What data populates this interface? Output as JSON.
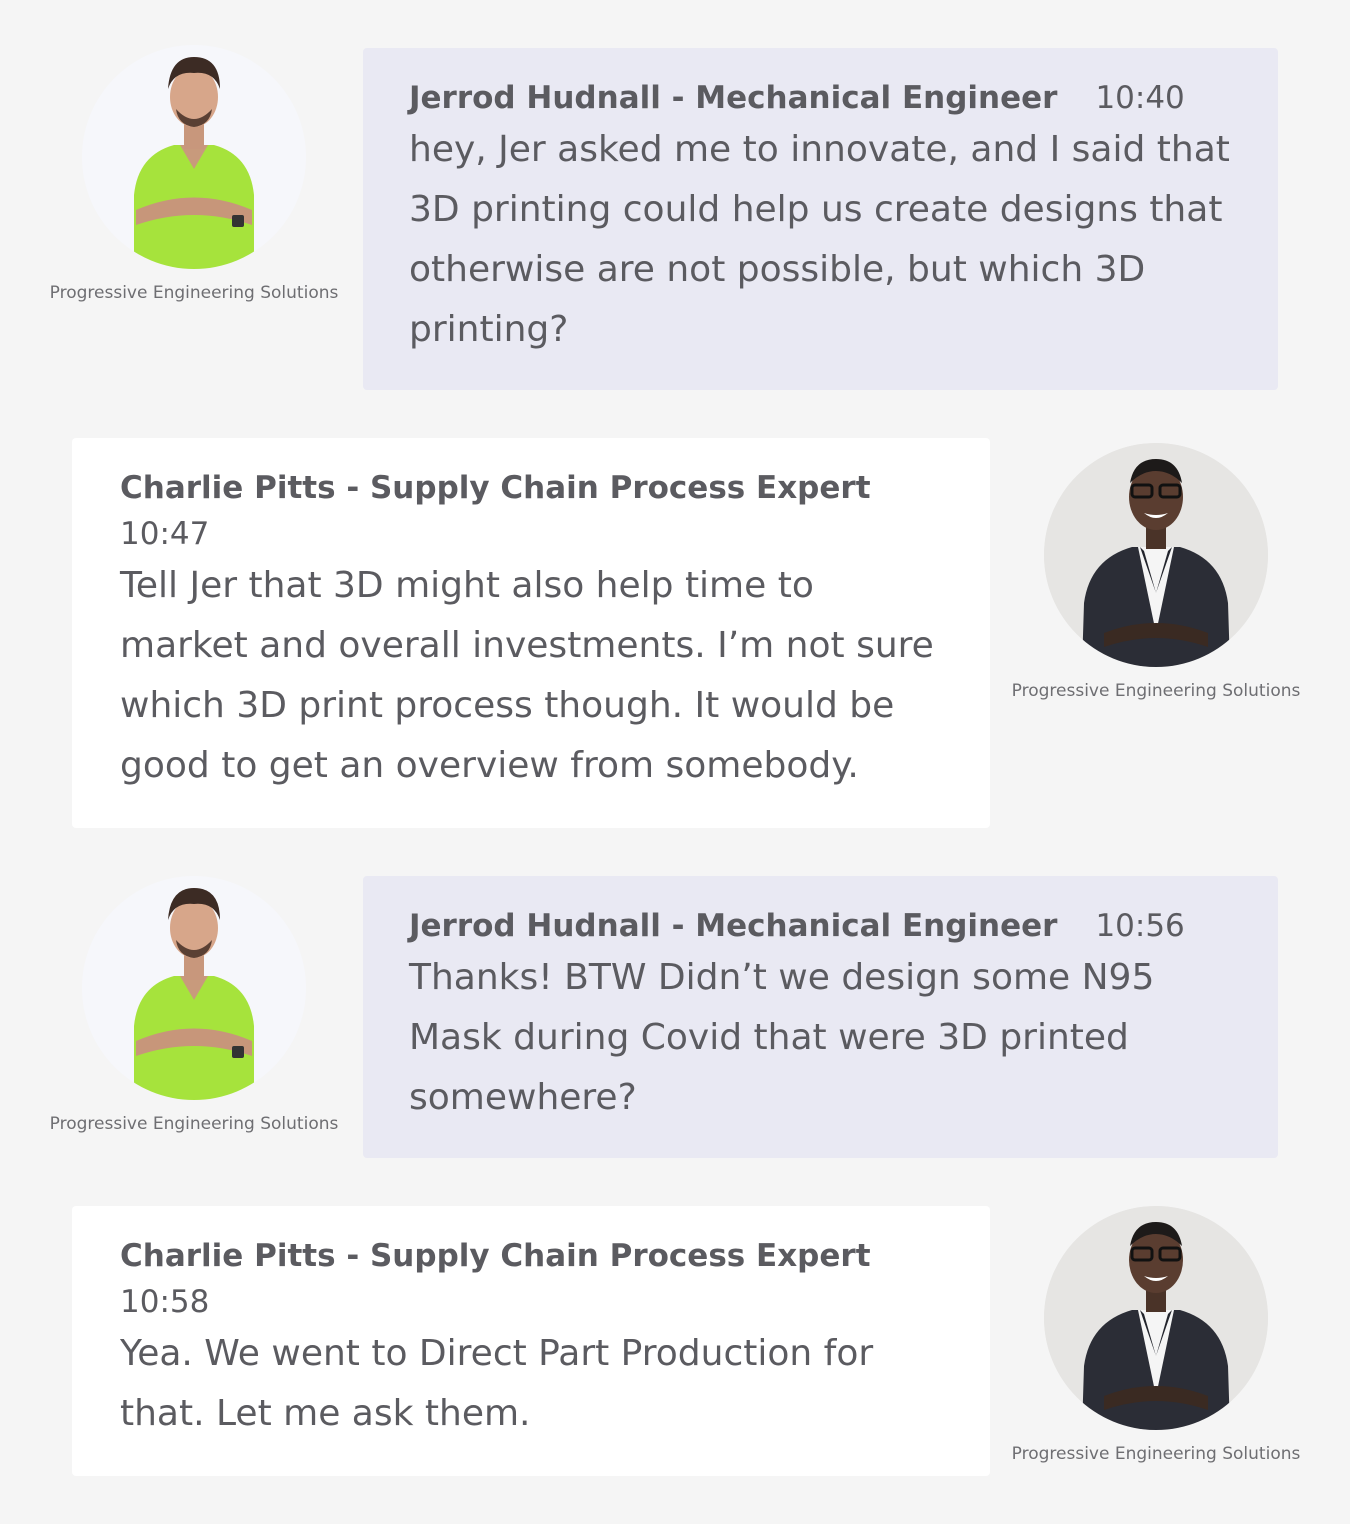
{
  "messages": [
    {
      "name": "Jerrod Hudnall - Mechanical Engineer",
      "time": "10:40",
      "text": "hey, Jer asked me to innovate, and I said that 3D printing could help us create designs that otherwise are not possible, but which 3D printing?",
      "org": "Progressive Engineering Solutions",
      "avatar": "man-green-polo-avatar"
    },
    {
      "name": "Charlie Pitts - Supply Chain Process Expert",
      "time": "10:47",
      "text": "Tell Jer that 3D might also help time to market and overall investments. I’m not sure which 3D print process though. It would be good to get an overview from somebody.",
      "org": "Progressive Engineering Solutions",
      "avatar": "man-suit-glasses-avatar"
    },
    {
      "name": "Jerrod Hudnall - Mechanical Engineer",
      "time": "10:56",
      "text": "Thanks! BTW Didn’t we design some N95 Mask during Covid that were 3D printed somewhere?",
      "org": "Progressive Engineering Solutions",
      "avatar": "man-green-polo-avatar"
    },
    {
      "name": "Charlie Pitts - Supply Chain Process Expert",
      "time": "10:58",
      "text": "Yea. We went to Direct Part Production for that. Let me ask them.",
      "org": "Progressive Engineering Solutions",
      "avatar": "man-suit-glasses-avatar"
    }
  ],
  "colors": {
    "page_bg": "#f5f5f5",
    "bubble_incoming": "#e9e9f3",
    "bubble_outgoing": "#ffffff",
    "text": "#5b5b60",
    "polo_green": "#a6e33c",
    "suit_dark": "#2b2d36"
  }
}
